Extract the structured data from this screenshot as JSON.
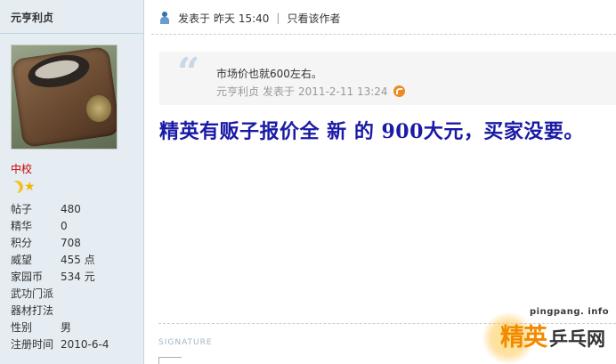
{
  "author": {
    "name": "元亨利贞",
    "rank": "中校",
    "stats": [
      {
        "label": "帖子",
        "value": "480"
      },
      {
        "label": "精华",
        "value": "0"
      },
      {
        "label": "积分",
        "value": "708"
      },
      {
        "label": "威望",
        "value": "455 点"
      },
      {
        "label": "家园币",
        "value": "534 元"
      },
      {
        "label": "武功门派",
        "value": ""
      },
      {
        "label": "器材打法",
        "value": ""
      },
      {
        "label": "性别",
        "value": "男"
      },
      {
        "label": "注册时间",
        "value": "2010-6-4"
      }
    ]
  },
  "post": {
    "posted_label": "发表于",
    "posted_time": "昨天 15:40",
    "separator": "|",
    "only_author_label": "只看该作者",
    "quote": {
      "text": "市场价也就600左右。",
      "author": "元亨利贞",
      "posted_label": "发表于",
      "time": "2011-2-11 13:24"
    },
    "body": "精英有贩子报价全 新 的 900大元，买家没要。",
    "signature_label": "SIGNATURE"
  },
  "watermark": {
    "url": "pingpang. info",
    "brand_orange": "精英",
    "brand_dark": "乒乓网"
  },
  "colors": {
    "sidebar_bg": "#e5edf2",
    "rank": "#cc0000",
    "body_text": "#1a1aa6",
    "watermark_orange": "#f28a00"
  }
}
